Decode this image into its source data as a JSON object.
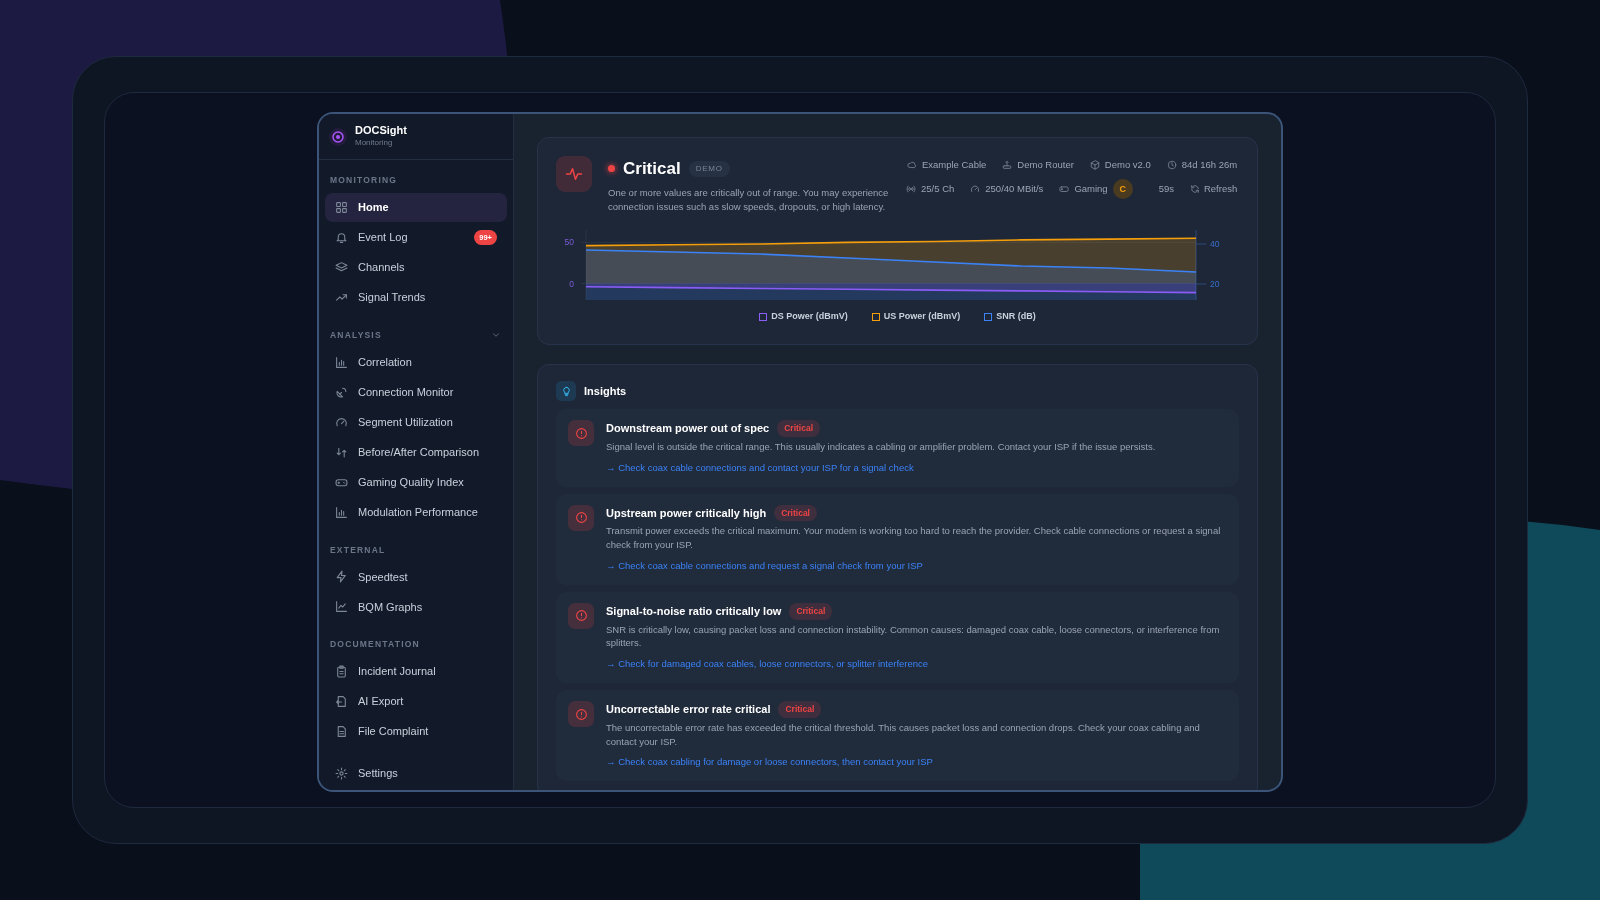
{
  "sidebar": {
    "brand": {
      "name": "DOCSight",
      "subtitle": "Monitoring"
    },
    "sections": [
      {
        "label": "MONITORING",
        "collapsible": false,
        "items": [
          {
            "label": "Home",
            "selected": true
          },
          {
            "label": "Event Log",
            "selected": false,
            "badge": "99+"
          },
          {
            "label": "Channels",
            "selected": false
          },
          {
            "label": "Signal Trends",
            "selected": false
          }
        ]
      },
      {
        "label": "ANALYSIS",
        "collapsible": true,
        "items": [
          {
            "label": "Correlation",
            "selected": false
          },
          {
            "label": "Connection Monitor",
            "selected": false
          },
          {
            "label": "Segment Utilization",
            "selected": false
          },
          {
            "label": "Before/After Comparison",
            "selected": false
          },
          {
            "label": "Gaming Quality Index",
            "selected": false
          },
          {
            "label": "Modulation Performance",
            "selected": false
          }
        ]
      },
      {
        "label": "EXTERNAL",
        "collapsible": false,
        "items": [
          {
            "label": "Speedtest",
            "selected": false
          },
          {
            "label": "BQM Graphs",
            "selected": false
          }
        ]
      },
      {
        "label": "DOCUMENTATION",
        "collapsible": false,
        "items": [
          {
            "label": "Incident Journal",
            "selected": false
          },
          {
            "label": "AI Export",
            "selected": false
          },
          {
            "label": "File Complaint",
            "selected": false
          }
        ]
      }
    ],
    "footer": {
      "label": "Settings",
      "selected": false
    }
  },
  "status": {
    "label": "Critical",
    "tag": "DEMO",
    "message": "One or more values are critically out of range. You may experience connection issues such as slow speeds, dropouts, or high latency.",
    "meta_row_1": [
      "Example Cable",
      "Demo Router",
      "Demo v2.0",
      "84d 16h 26m"
    ],
    "meta_row_2": {
      "channels": "25/5 Ch",
      "speed": "250/40 MBit/s",
      "gaming": "Gaming",
      "grade": "C",
      "timer": "59s",
      "refresh": "Refresh"
    },
    "chart_data": {
      "type": "area",
      "ylim": [
        -20,
        65
      ],
      "yticks": [
        0,
        50
      ],
      "y2lim": [
        12,
        47
      ],
      "y2ticks": [
        20,
        40
      ],
      "series": [
        {
          "name": "DS Power (dBmV)",
          "color": "#8b5cf6",
          "values": [
            -4,
            -5,
            -6,
            -7,
            -8,
            -9,
            -10,
            -11
          ]
        },
        {
          "name": "US Power (dBmV)",
          "color": "#f59e0b",
          "values": [
            46,
            47,
            48,
            50,
            51,
            53,
            54,
            55
          ]
        },
        {
          "name": "SNR (dB)",
          "color": "#3b82f6",
          "axis": "y2",
          "values": [
            37,
            36,
            35,
            33,
            31,
            29,
            28,
            26
          ]
        }
      ]
    }
  },
  "insights": {
    "title": "Insights",
    "items": [
      {
        "title": "Downstream power out of spec",
        "badge": "Critical",
        "text": "Signal level is outside the critical range. This usually indicates a cabling or amplifier problem. Contact your ISP if the issue persists.",
        "action": "→ Check coax cable connections and contact your ISP for a signal check"
      },
      {
        "title": "Upstream power critically high",
        "badge": "Critical",
        "text": "Transmit power exceeds the critical maximum. Your modem is working too hard to reach the provider. Check cable connections or request a signal check from your ISP.",
        "action": "→ Check coax cable connections and request a signal check from your ISP"
      },
      {
        "title": "Signal-to-noise ratio critically low",
        "badge": "Critical",
        "text": "SNR is critically low, causing packet loss and connection instability. Common causes: damaged coax cable, loose connectors, or interference from splitters.",
        "action": "→ Check for damaged coax cables, loose connectors, or splitter interference"
      },
      {
        "title": "Uncorrectable error rate critical",
        "badge": "Critical",
        "text": "The uncorrectable error rate has exceeded the critical threshold. This causes packet loss and connection drops. Check your coax cabling and contact your ISP.",
        "action": "→ Check coax cabling for damage or loose connectors, then contact your ISP"
      }
    ]
  }
}
